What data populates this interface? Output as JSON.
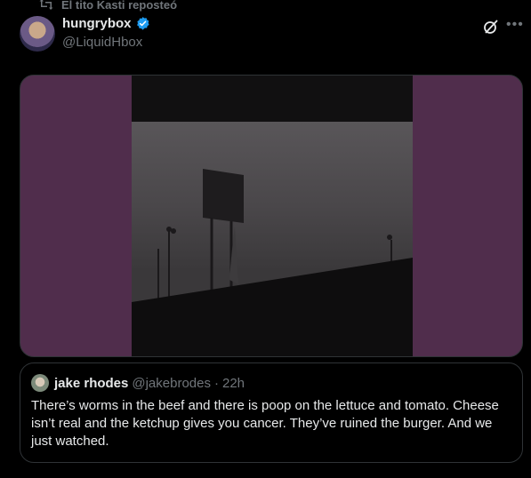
{
  "repost": {
    "label": "El tito Kasti reposteó"
  },
  "author": {
    "display_name": "hungrybox",
    "handle": "@LiquidHbox"
  },
  "quote": {
    "display_name": "jake rhodes",
    "handle": "@jakebrodes",
    "separator": "·",
    "time": "22h",
    "text": "There’s worms in the beef and there is poop on the lettuce and tomato. Cheese isn’t real and the ketchup gives you cancer. They’ve ruined the burger. And we just watched."
  },
  "icons": {
    "repost": "repost-icon",
    "verified": "verified-icon",
    "grok": "grok-icon",
    "more": "more-icon"
  },
  "colors": {
    "background": "#000000",
    "text": "#e7e9ea",
    "muted": "#71767b",
    "verified": "#1d9bf0",
    "media_background": "#502d4c",
    "border": "#2f3336"
  }
}
